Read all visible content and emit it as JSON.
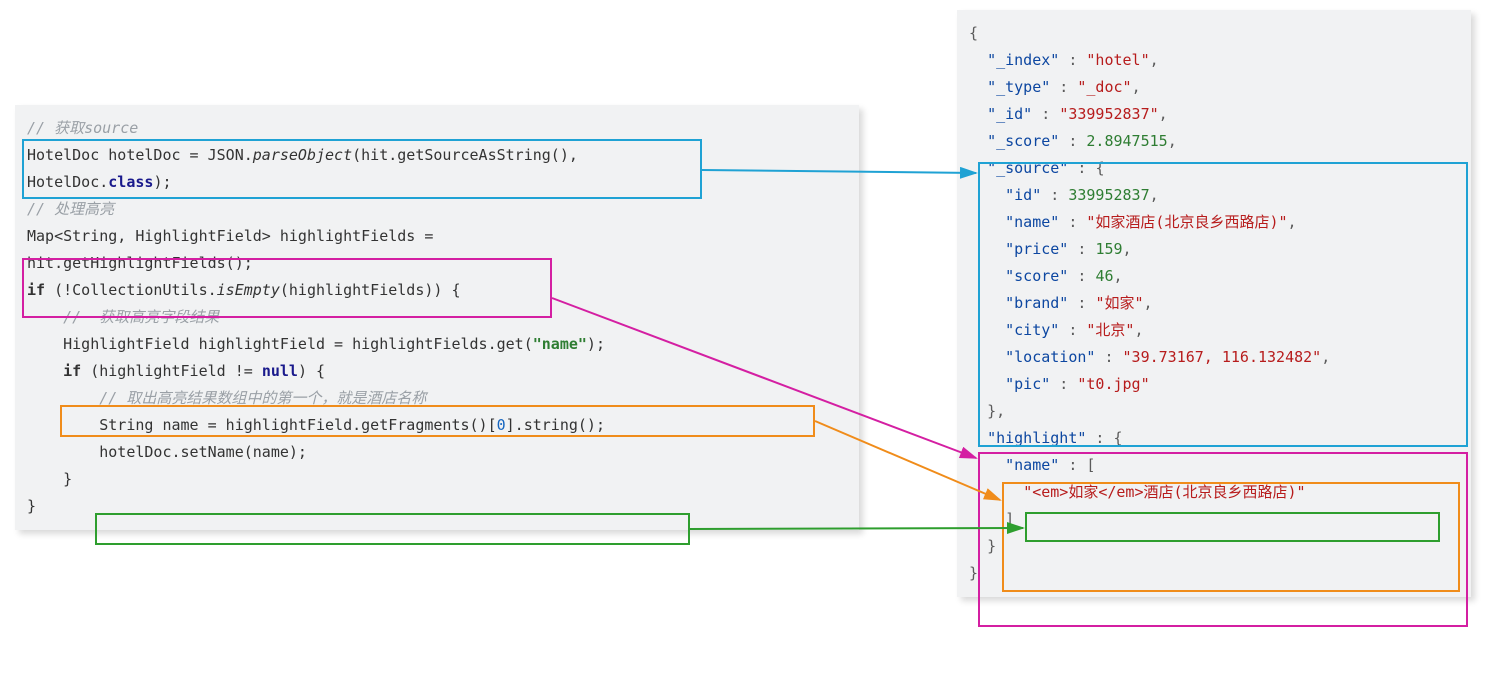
{
  "left": {
    "comment_source": "// 获取source",
    "line_parse": "HotelDoc hotelDoc = JSON.parseObject(hit.getSourceAsString(),\nHotelDoc.class);",
    "line_parse_p1": "HotelDoc hotelDoc = JSON.",
    "line_parse_method": "parseObject",
    "line_parse_p2": "(hit.getSourceAsString(),",
    "line_parse_p3": "HotelDoc.",
    "line_parse_kw": "class",
    "line_parse_p4": ");",
    "comment_highlight": "// 处理高亮",
    "line_map": "Map<String, HighlightField> highlightFields =\nhit.getHighlightFields();",
    "line_if1_p1": "if",
    "line_if1_p2": " (!CollectionUtils.",
    "line_if1_method": "isEmpty",
    "line_if1_p3": "(highlightFields)) {",
    "comment_get_field": "//  获取高亮字段结果",
    "line_get_p1": "HighlightField highlightField = highlightFields.get(",
    "line_get_str": "\"name\"",
    "line_get_p2": ");",
    "line_if2_p1": "if",
    "line_if2_p2": " (highlightField != ",
    "line_if2_null": "null",
    "line_if2_p3": ") {",
    "comment_frag": "// 取出高亮结果数组中的第一个，就是酒店名称",
    "line_frag_p1": "String name = highlightField.getFragments()[",
    "line_frag_idx": "0",
    "line_frag_p2": "].string();",
    "line_setname": "hotelDoc.setName(name);",
    "brace_close_inner": "}",
    "brace_close_outer": "}"
  },
  "right": {
    "brace_open": "{",
    "k_index": "\"_index\"",
    "v_index": "\"hotel\"",
    "k_type": "\"_type\"",
    "v_type": "\"_doc\"",
    "k_id": "\"_id\"",
    "v_id": "\"339952837\"",
    "k_score": "\"_score\"",
    "v_score": "2.8947515",
    "k_source": "\"_source\"",
    "v_source_open": "{",
    "k_sid": "\"id\"",
    "v_sid": "339952837",
    "k_name": "\"name\"",
    "v_name": "\"如家酒店(北京良乡西路店)\"",
    "k_price": "\"price\"",
    "v_price": "159",
    "k_sscore": "\"score\"",
    "v_sscore": "46",
    "k_brand": "\"brand\"",
    "v_brand": "\"如家\"",
    "k_city": "\"city\"",
    "v_city": "\"北京\"",
    "k_loc": "\"location\"",
    "v_loc": "\"39.73167, 116.132482\"",
    "k_pic": "\"pic\"",
    "v_pic": "\"t0.jpg\"",
    "src_close": "},",
    "k_hl": "\"highlight\"",
    "v_hl_open": "{",
    "k_hlname": "\"name\"",
    "v_hlname_open": "[",
    "v_hlfrag": "\"<em>如家</em>酒店(北京良乡西路店)\"",
    "hlname_close": "]",
    "hl_close": "}",
    "brace_close": "}"
  },
  "colors": {
    "blue": "#1FA2D4",
    "magenta": "#D41FA2",
    "orange": "#F08C1A",
    "green": "#2E9E2E"
  }
}
